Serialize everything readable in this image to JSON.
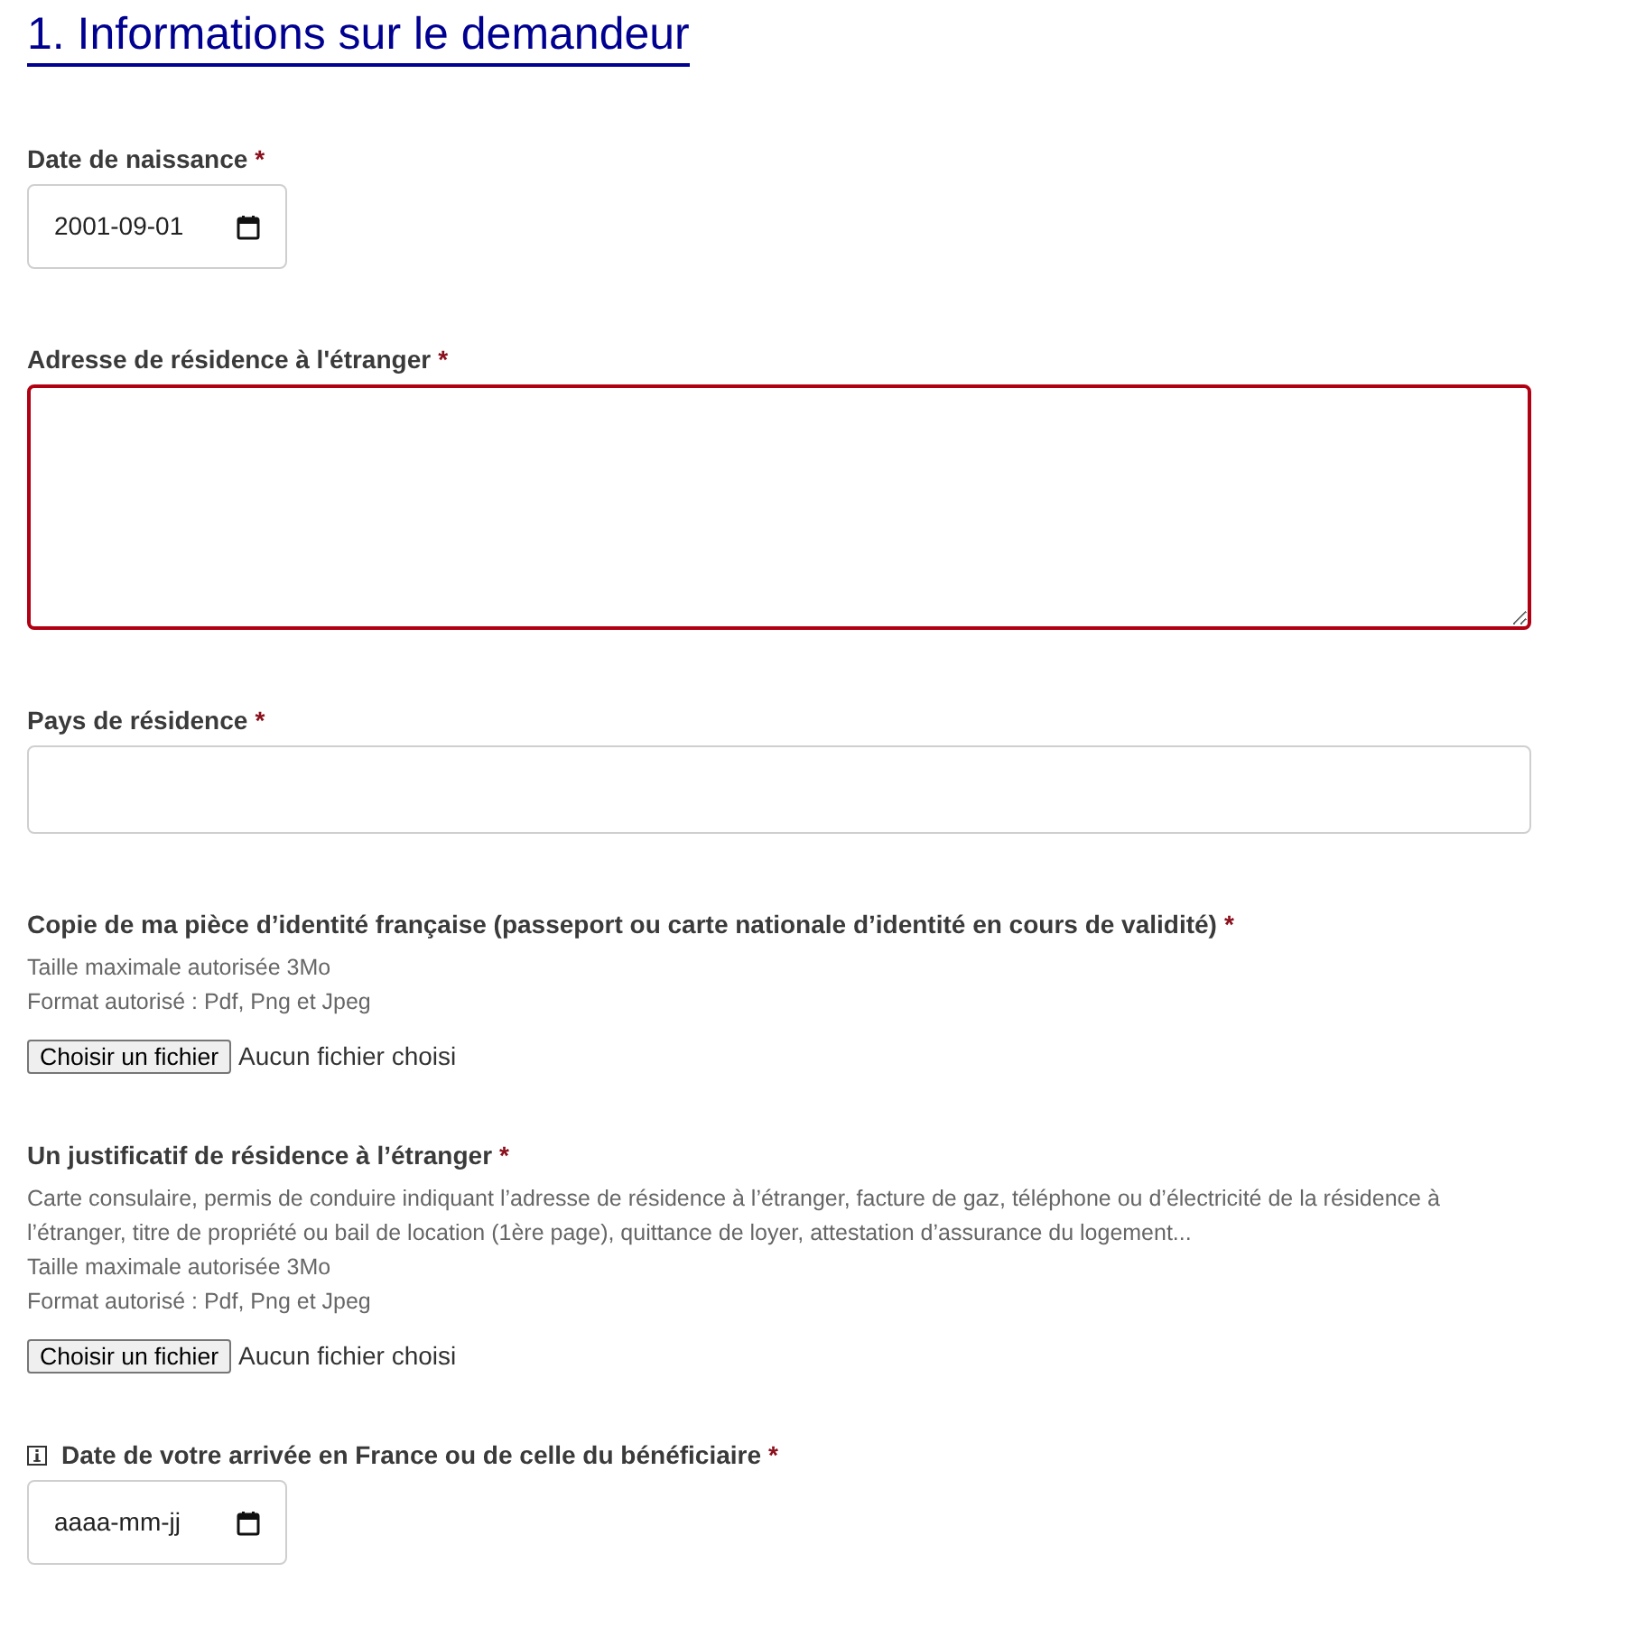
{
  "heading": "1. Informations sur le demandeur",
  "fields": [
    {
      "kind": "date",
      "label": "Date de naissance",
      "required_mark": "*",
      "has_info_icon": false,
      "invalid": false,
      "value": "2001-09-01"
    },
    {
      "kind": "textarea",
      "label": "Adresse de résidence à l'étranger",
      "required_mark": "*",
      "has_info_icon": false,
      "invalid": true
    },
    {
      "kind": "text",
      "label": "Pays de résidence",
      "required_mark": "*",
      "has_info_icon": false,
      "invalid": false
    },
    {
      "kind": "file",
      "label": "Copie de ma pièce d’identité française (passeport ou carte nationale d’identité en cours de validité)",
      "required_mark": "*",
      "has_info_icon": false,
      "invalid": false,
      "hints": [
        "Taille maximale autorisée 3Mo",
        "Format autorisé : Pdf, Png et Jpeg"
      ],
      "button": "Choisir un fichier",
      "status": "Aucun fichier choisi"
    },
    {
      "kind": "file",
      "label": "Un justificatif de résidence à l’étranger",
      "required_mark": "*",
      "has_info_icon": false,
      "invalid": false,
      "description": "Carte consulaire, permis de conduire indiquant l’adresse de résidence à l’étranger, facture de gaz, téléphone ou d’électricité de la résidence à l’étranger, titre de propriété ou bail de location (1ère page), quittance de loyer, attestation d’assurance du logement...",
      "hints": [
        "Taille maximale autorisée 3Mo",
        "Format autorisé : Pdf, Png et Jpeg"
      ],
      "button": "Choisir un fichier",
      "status": "Aucun fichier choisi"
    },
    {
      "kind": "date",
      "label": "Date de votre arrivée en France ou de celle du bénéficiaire",
      "required_mark": "*",
      "has_info_icon": true,
      "invalid": false,
      "placeholder": "aaaa-mm-jj"
    }
  ]
}
